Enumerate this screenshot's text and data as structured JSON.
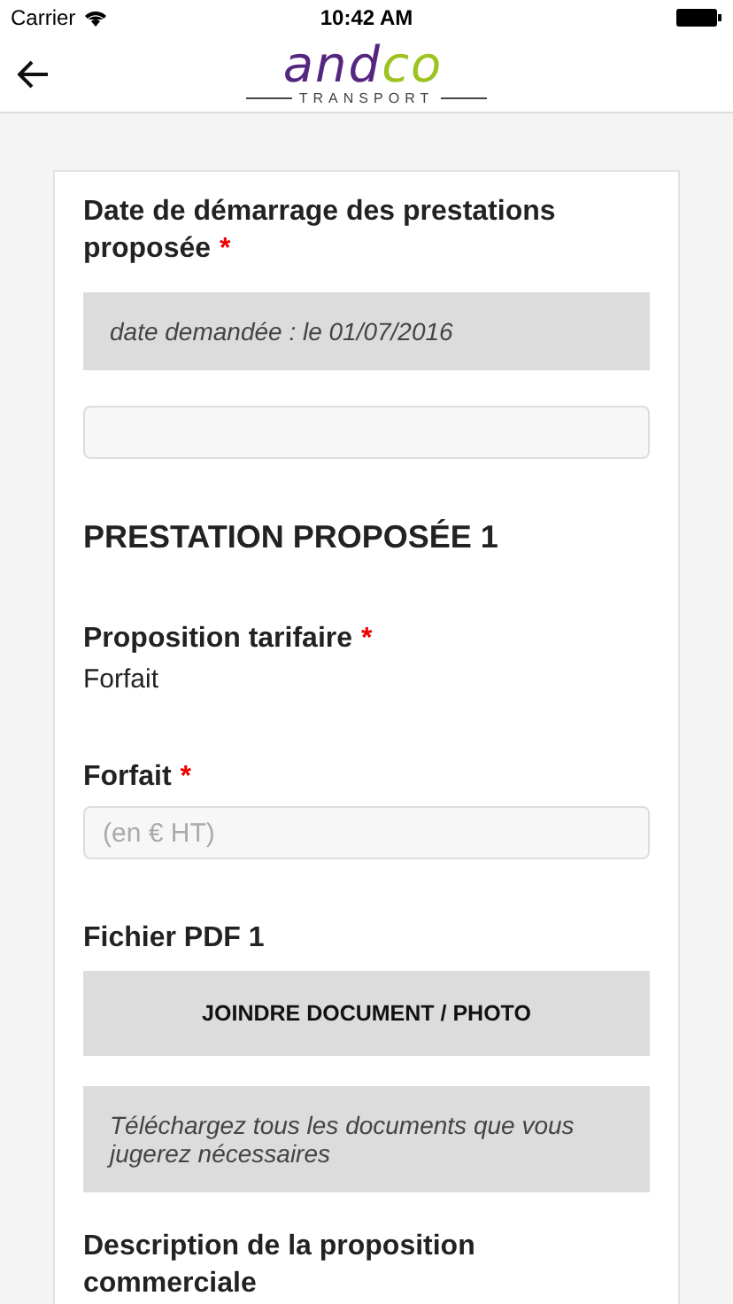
{
  "status_bar": {
    "carrier": "Carrier",
    "time": "10:42 AM"
  },
  "header": {
    "logo": {
      "left": "and",
      "right": "co",
      "tagline": "TRANSPORT"
    }
  },
  "form": [
    {
      "kind": "label",
      "text": "Date de démarrage des prestations proposée",
      "mark": "*"
    },
    {
      "kind": "note",
      "text": "date demandée : le 01/07/2016"
    },
    {
      "kind": "input"
    },
    {
      "kind": "heading",
      "text": "PRESTATION PROPOSÉE 1"
    },
    {
      "kind": "label",
      "text": "Proposition tarifaire",
      "mark": "*"
    },
    {
      "kind": "value",
      "text": "Forfait"
    },
    {
      "kind": "label",
      "text": "Forfait",
      "mark": "*"
    },
    {
      "kind": "input",
      "placeholder": "(en € HT)"
    },
    {
      "kind": "label",
      "text": "Fichier PDF 1"
    },
    {
      "kind": "button",
      "text": "JOINDRE DOCUMENT / PHOTO"
    },
    {
      "kind": "note",
      "text": "Téléchargez tous les documents que vous jugerez nécessaires"
    },
    {
      "kind": "label",
      "text": "Description de la proposition commerciale"
    }
  ]
}
